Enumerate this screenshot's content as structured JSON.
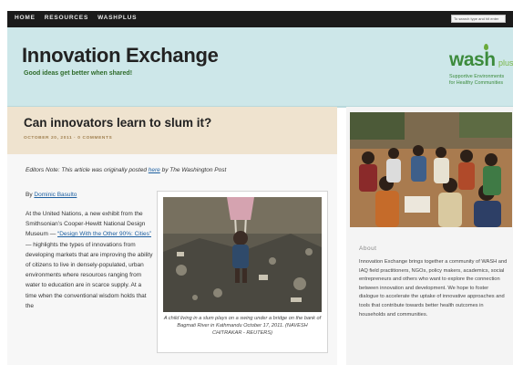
{
  "nav": {
    "items": [
      "HOME",
      "RESOURCES",
      "WASHPLUS"
    ],
    "search_placeholder": "To search type and hit enter"
  },
  "header": {
    "title": "Innovation Exchange",
    "tagline": "Good ideas get better when shared!",
    "logo": {
      "word": "wash",
      "plus": "plus",
      "sub_line1": "Supportive Environments",
      "sub_line2": "for Healthy Communities"
    }
  },
  "post": {
    "title": "Can innovators learn to slum it?",
    "meta": "OCTOBER 20, 2011 · 0 COMMENTS",
    "note_prefix": "Editors Note: This article was originally posted ",
    "note_link": "here",
    "note_suffix": " by The Washington Post",
    "byline_prefix": "By ",
    "author": "Dominic Basulto",
    "body_part1": "At the United Nations, a new exhibit from the Smithsonian’s Cooper-Hewitt National Design Museum — ",
    "body_link": "“Design With the Other 90%: Cities”",
    "body_part2": " — highlights the types of innovations from developing markets that are improving the ability of citizens to live in densely-populated, urban environments where resources ranging from water to education are in scarce supply. At a time when the conventional wisdom holds that the",
    "image_caption": "A child living in a slum plays on a swing under a bridge on the bank of Bagmati River in Kathmandu October 17, 2011. (NAVESH CHITRAKAR - REUTERS)"
  },
  "sidebar": {
    "about_title": "About",
    "about_text": "Innovation Exchange brings together a community of WASH and IAQ field practitioners, NGOs, policy makers, academics, social entrepreneurs and others who want to explore the connection between innovation and development. We hope to foster dialogue to accelerate the uptake of innovative approaches and tools that contribute towards better health outcomes in households and communities."
  },
  "colors": {
    "header_bg": "#cde7e9",
    "post_header_bg": "#efe3cf",
    "link": "#1d5fa0",
    "brand_green": "#3c8b3c"
  }
}
